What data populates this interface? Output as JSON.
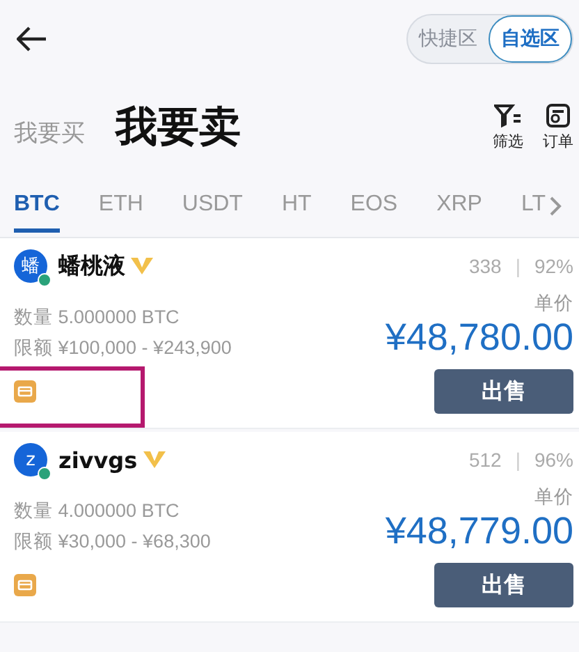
{
  "mode_toggle": [
    {
      "label": "快捷区",
      "selected": false
    },
    {
      "label": "自选区",
      "selected": true
    }
  ],
  "side_tabs": [
    {
      "label": "我要买",
      "selected": false
    },
    {
      "label": "我要卖",
      "selected": true
    }
  ],
  "actions": [
    {
      "kind": "filter",
      "label": "筛选"
    },
    {
      "kind": "orders",
      "label": "订单"
    }
  ],
  "coin_tabs": [
    {
      "label": "BTC",
      "selected": true
    },
    {
      "label": "ETH",
      "selected": false
    },
    {
      "label": "USDT",
      "selected": false
    },
    {
      "label": "HT",
      "selected": false
    },
    {
      "label": "EOS",
      "selected": false
    },
    {
      "label": "XRP",
      "selected": false
    },
    {
      "label": "LT",
      "selected": false
    }
  ],
  "offers": [
    {
      "avatar": "蟠",
      "name": "蟠桃液",
      "verified": true,
      "online": true,
      "orders": "338",
      "separator": "|",
      "rate": "92%",
      "quantity": "数量 5.000000 BTC",
      "limit": "限额 ¥100,000 - ¥243,900",
      "price_label": "单价",
      "price": "¥48,780.00",
      "button": "出售",
      "highlighted": true
    },
    {
      "avatar": "z",
      "name": "zivvgs",
      "verified": true,
      "online": true,
      "orders": "512",
      "separator": "|",
      "rate": "96%",
      "quantity": "数量 4.000000 BTC",
      "limit": "限额 ¥30,000 - ¥68,300",
      "price_label": "单价",
      "price": "¥48,779.00",
      "button": "出售",
      "highlighted": false
    }
  ]
}
